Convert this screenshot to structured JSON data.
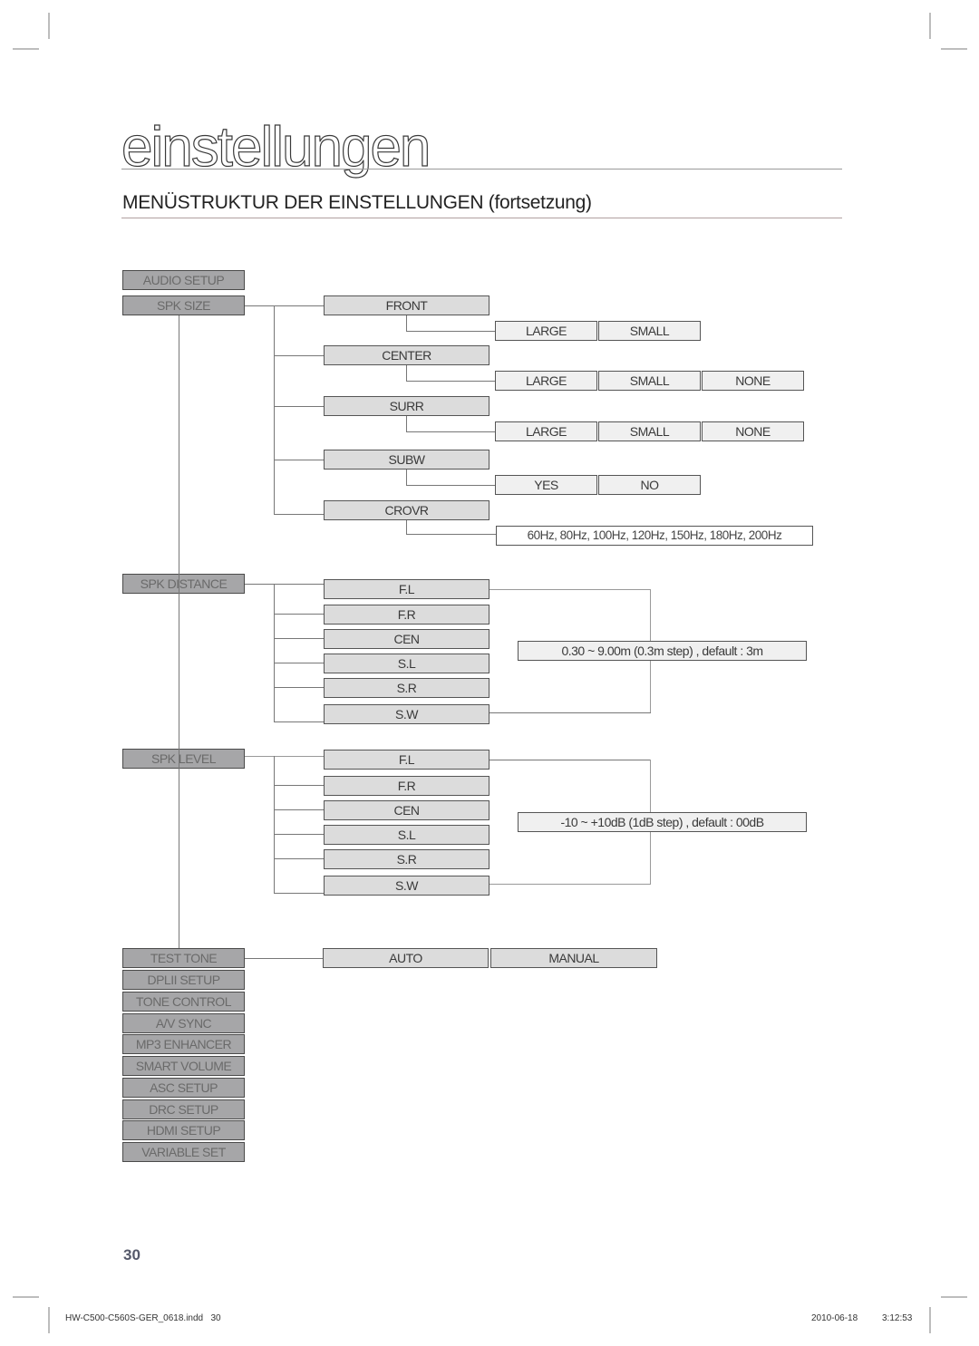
{
  "page": {
    "section_title": "einstellungen",
    "heading": "MENÜSTRUKTUR DER EINSTELLUNGEN (fortsetzung)",
    "page_number": "30",
    "footer_file": "HW-C500-C560S-GER_0618.indd   30",
    "footer_date": "2010-06-18",
    "footer_time": "3:12:53"
  },
  "menu": {
    "root": "AUDIO SETUP",
    "items": [
      "SPK SIZE",
      "SPK DISTANCE",
      "SPK LEVEL",
      "TEST TONE",
      "DPLII SETUP",
      "TONE CONTROL",
      "A/V SYNC",
      "MP3 ENHANCER",
      "SMART VOLUME",
      "ASC SETUP",
      "DRC SETUP",
      "HDMI SETUP",
      "VARIABLE SET"
    ]
  },
  "spk_size": {
    "front": {
      "label": "FRONT",
      "options": [
        "LARGE",
        "SMALL"
      ]
    },
    "center": {
      "label": "CENTER",
      "options": [
        "LARGE",
        "SMALL",
        "NONE"
      ]
    },
    "surr": {
      "label": "SURR",
      "options": [
        "LARGE",
        "SMALL",
        "NONE"
      ]
    },
    "subw": {
      "label": "SUBW",
      "options": [
        "YES",
        "NO"
      ]
    },
    "crovr": {
      "label": "CROVR",
      "options": [
        "60Hz, 80Hz, 100Hz, 120Hz, 150Hz, 180Hz, 200Hz"
      ]
    }
  },
  "spk_distance": {
    "channels": [
      "F.L",
      "F.R",
      "CEN",
      "S.L",
      "S.R",
      "S.W"
    ],
    "range": "0.30 ~ 9.00m (0.3m step) , default : 3m"
  },
  "spk_level": {
    "channels": [
      "F.L",
      "F.R",
      "CEN",
      "S.L",
      "S.R",
      "S.W"
    ],
    "range": "-10 ~ +10dB (1dB step) , default : 00dB"
  },
  "test_tone": {
    "options": [
      "AUTO",
      "MANUAL"
    ]
  }
}
